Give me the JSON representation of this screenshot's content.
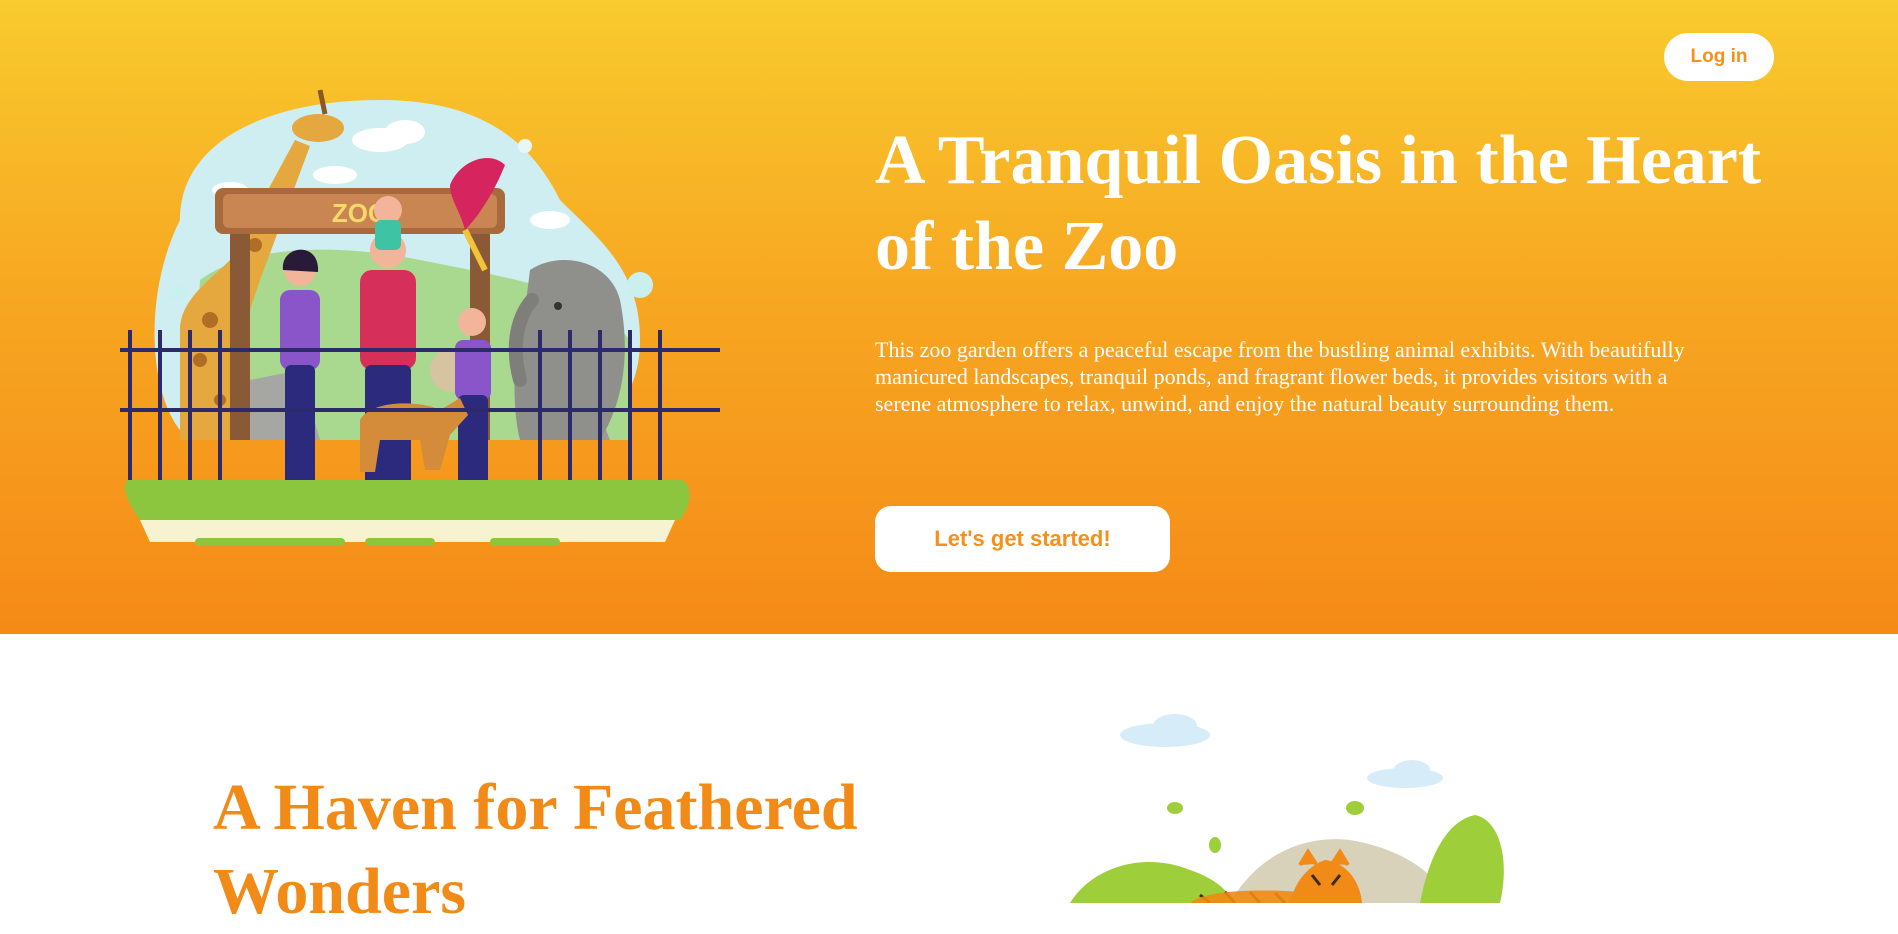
{
  "header": {
    "login_label": "Log in"
  },
  "hero": {
    "title": "A Tranquil Oasis in the Heart of the Zoo",
    "description": "This zoo garden offers a peaceful escape from the bustling animal exhibits. With beautifully manicured landscapes, tranquil ponds, and fragrant flower beds, it provides visitors with a serene atmosphere to relax, unwind, and enjoy the natural beauty surrounding them.",
    "cta_label": "Let's get started!",
    "illustration_sign_text": "ZOO"
  },
  "section2": {
    "title": "A Haven for Feathered Wonders"
  },
  "colors": {
    "accent": "#f4901c",
    "hero_top": "#f8cb2e",
    "hero_bottom": "#f58a17",
    "white": "#ffffff"
  }
}
